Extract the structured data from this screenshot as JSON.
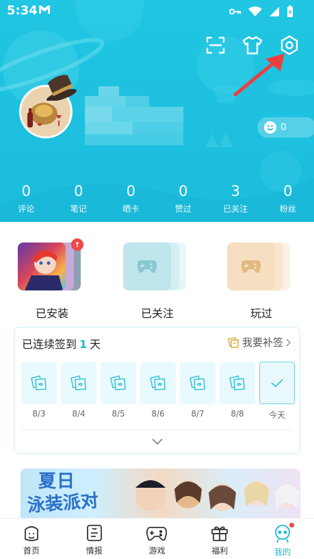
{
  "status_bar": {
    "time": "5:34"
  },
  "header": {
    "top_icons": [
      "scan-icon",
      "outfit-icon",
      "settings-icon"
    ],
    "like_count": "0",
    "stats": [
      {
        "value": "0",
        "label": "评论"
      },
      {
        "value": "0",
        "label": "笔记"
      },
      {
        "value": "0",
        "label": "晒卡"
      },
      {
        "value": "0",
        "label": "赞过"
      },
      {
        "value": "3",
        "label": "已关注"
      },
      {
        "value": "0",
        "label": "粉丝"
      }
    ]
  },
  "shelves": [
    {
      "label": "已安装"
    },
    {
      "label": "已关注"
    },
    {
      "label": "玩过"
    }
  ],
  "checkin": {
    "title_prefix": "已连续签到",
    "count": "1",
    "title_suffix": "天",
    "makeup_label": "我要补签",
    "days": [
      {
        "label": "8/3"
      },
      {
        "label": "8/4"
      },
      {
        "label": "8/5"
      },
      {
        "label": "8/6"
      },
      {
        "label": "8/7"
      },
      {
        "label": "8/8"
      },
      {
        "label": "今天"
      }
    ]
  },
  "banner": {
    "line1": "夏日",
    "line2": "泳装派对"
  },
  "nav": [
    {
      "label": "首页"
    },
    {
      "label": "情报"
    },
    {
      "label": "游戏"
    },
    {
      "label": "福利"
    },
    {
      "label": "我的"
    }
  ],
  "colors": {
    "accent": "#1bbcdc",
    "badge": "#f04848"
  }
}
